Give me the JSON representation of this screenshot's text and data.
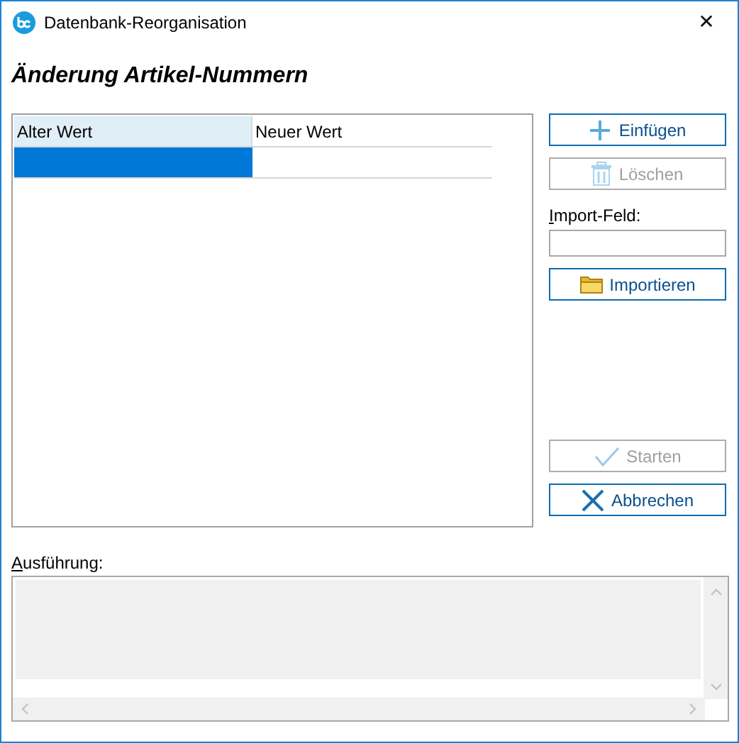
{
  "window": {
    "title": "Datenbank-Reorganisation",
    "close": "✕"
  },
  "heading": "Änderung Artikel-Nummern",
  "table": {
    "columns": [
      {
        "label": "Alter Wert",
        "selected": true
      },
      {
        "label": "Neuer Wert",
        "selected": false
      }
    ],
    "rows": [
      {
        "selected": true
      }
    ]
  },
  "insert_button": {
    "label": "Einfügen",
    "disabled": false
  },
  "delete_button": {
    "label": "Löschen",
    "disabled": true
  },
  "import_field": {
    "label": "Import-Feld:"
  },
  "import_button": {
    "label": "Importieren",
    "disabled": false
  },
  "start_button": {
    "label": "Starten",
    "disabled": true
  },
  "cancel_button": {
    "label": "Abbrechen",
    "disabled": false
  },
  "output": {
    "label": "Ausführung:"
  }
}
